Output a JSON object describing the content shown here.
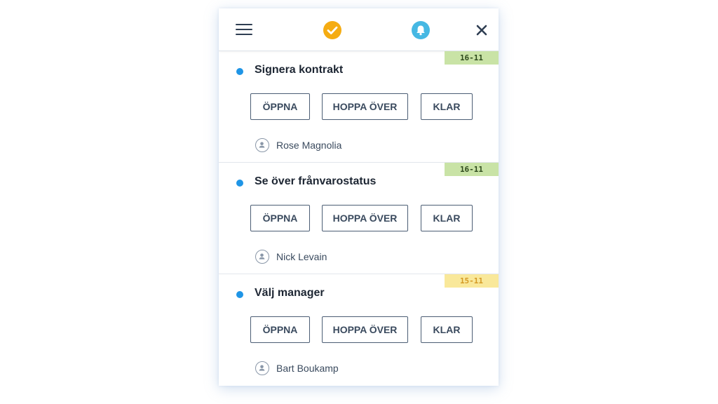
{
  "header": {
    "icons": [
      "menu-icon",
      "check-icon",
      "bell-icon",
      "close-icon"
    ],
    "check_color": "#f5ac12",
    "bell_color": "#46b8e3"
  },
  "tasks": [
    {
      "date": "16-11",
      "date_color": "#c9e3a6",
      "title": "Signera kontrakt",
      "actions": {
        "open": "ÖPPNA",
        "skip": "HOPPA ÖVER",
        "done": "KLAR"
      },
      "assignee": "Rose Magnolia"
    },
    {
      "date": "16-11",
      "date_color": "#c9e3a6",
      "title": "Se över frånvarostatus",
      "actions": {
        "open": "ÖPPNA",
        "skip": "HOPPA ÖVER",
        "done": "KLAR"
      },
      "assignee": "Nick Levain"
    },
    {
      "date": "15-11",
      "date_color": "#f9e89a",
      "title": "Välj manager",
      "actions": {
        "open": "ÖPPNA",
        "skip": "HOPPA ÖVER",
        "done": "KLAR"
      },
      "assignee": "Bart Boukamp"
    }
  ]
}
